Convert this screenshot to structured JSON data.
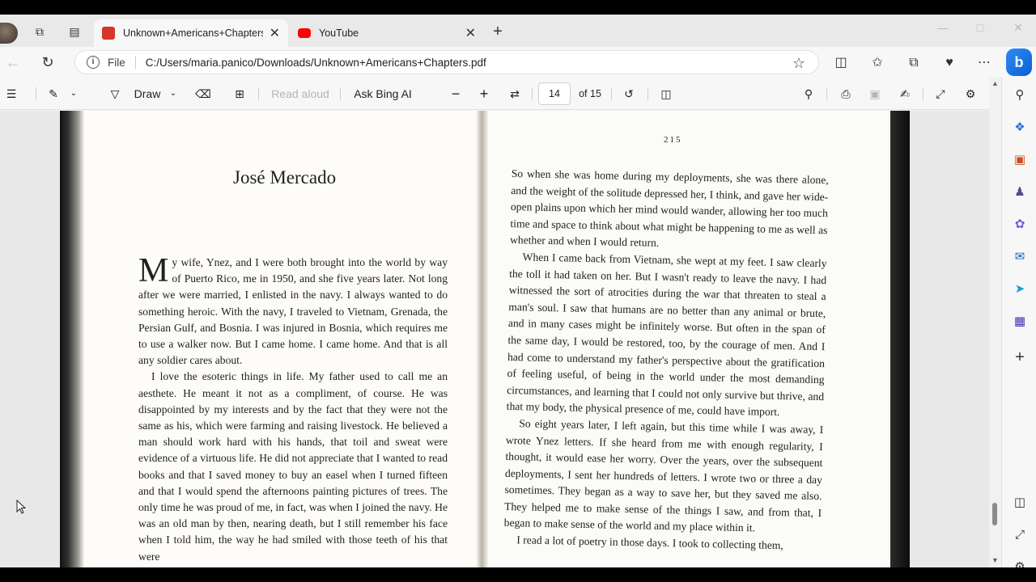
{
  "tabs": [
    {
      "title": "Unknown+Americans+Chapters.pdf",
      "favicon": "pdf-icon",
      "active": true
    },
    {
      "title": "YouTube",
      "favicon": "youtube-icon",
      "active": false
    }
  ],
  "address": {
    "scheme": "File",
    "url": "C:/Users/maria.panico/Downloads/Unknown+Americans+Chapters.pdf"
  },
  "pdf_toolbar": {
    "draw_label": "Draw",
    "read_aloud_label": "Read aloud",
    "ask_bing_label": "Ask Bing AI",
    "page_current": "14",
    "page_total": "of 15"
  },
  "document": {
    "chapter_title": "José Mercado",
    "right_page_number": "215",
    "left_dropcap": "M",
    "left_paragraphs": [
      "y wife, Ynez, and I were both brought into the world by way of Puerto Rico, me in 1950, and she five years later. Not long after we were married, I enlisted in the navy. I always wanted to do something heroic. With the navy, I traveled to Vietnam, Grenada, the Persian Gulf, and Bosnia. I was injured in Bosnia, which requires me to use a walker now. But I came home. I came home. And that is all any soldier cares about.",
      "I love the esoteric things in life. My father used to call me an aesthete. He meant it not as a compliment, of course. He was disappointed by my interests and by the fact that they were not the same as his, which were farming and raising livestock. He believed a man should work hard with his hands, that toil and sweat were evidence of a virtuous life. He did not appreciate that I wanted to read books and that I saved money to buy an easel when I turned fifteen and that I would spend the afternoons painting pictures of trees. The only time he was proud of me, in fact, was when I joined the navy. He was an old man by then, nearing death, but I still remember his face when I told him, the way he had smiled with those teeth of his that were"
    ],
    "right_paragraphs": [
      "So when she was home during my deployments, she was there alone, and the weight of the solitude depressed her, I think, and gave her wide-open plains upon which her mind would wander, allowing her too much time and space to think about what might be happening to me as well as whether and when I would return.",
      "When I came back from Vietnam, she wept at my feet. I saw clearly the toll it had taken on her. But I wasn't ready to leave the navy. I had witnessed the sort of atrocities during the war that threaten to steal a man's soul. I saw that humans are no better than any animal or brute, and in many cases might be infinitely worse. But often in the span of the same day, I would be restored, too, by the courage of men. And I had come to understand my father's perspective about the gratification of feeling useful, of being in the world under the most demanding circumstances, and learning that I could not only survive but thrive, and that my body, the physical presence of me, could have import.",
      "So eight years later, I left again, but this time while I was away, I wrote Ynez letters. If she heard from me with enough regularity, I thought, it would ease her worry. Over the years, over the subsequent deployments, I sent her hundreds of letters. I wrote two or three a day sometimes. They began as a way to save her, but they saved me also. They helped me to make sense of the things I saw, and from that, I began to make sense of the world and my place within it.",
      "I read a lot of poetry in those days. I took to collecting them,"
    ]
  },
  "colors": {
    "accent": "#0b5fd1",
    "pdf_favicon": "#d9342b",
    "youtube_favicon": "#ff0000"
  }
}
